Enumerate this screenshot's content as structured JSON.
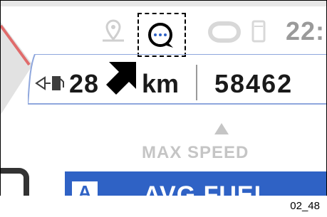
{
  "status": {
    "time_partial": "22:"
  },
  "trip": {
    "range_value": "28",
    "range_unit": "km",
    "odometer": "58462"
  },
  "max_speed_label": "MAX SPEED",
  "bottom": {
    "letter": "A",
    "label": "AVG FUEL"
  },
  "footer_code": "02_48",
  "colors": {
    "accent_blue": "#2f62c5",
    "faded_gray": "#cfcfcf",
    "line_blue": "#8fa7dd"
  },
  "icons": [
    "map-pin-icon",
    "chat-bubble-icon",
    "phone-link-icon",
    "phone-icon",
    "fuel-pump-icon",
    "cursor-arrow-icon"
  ]
}
